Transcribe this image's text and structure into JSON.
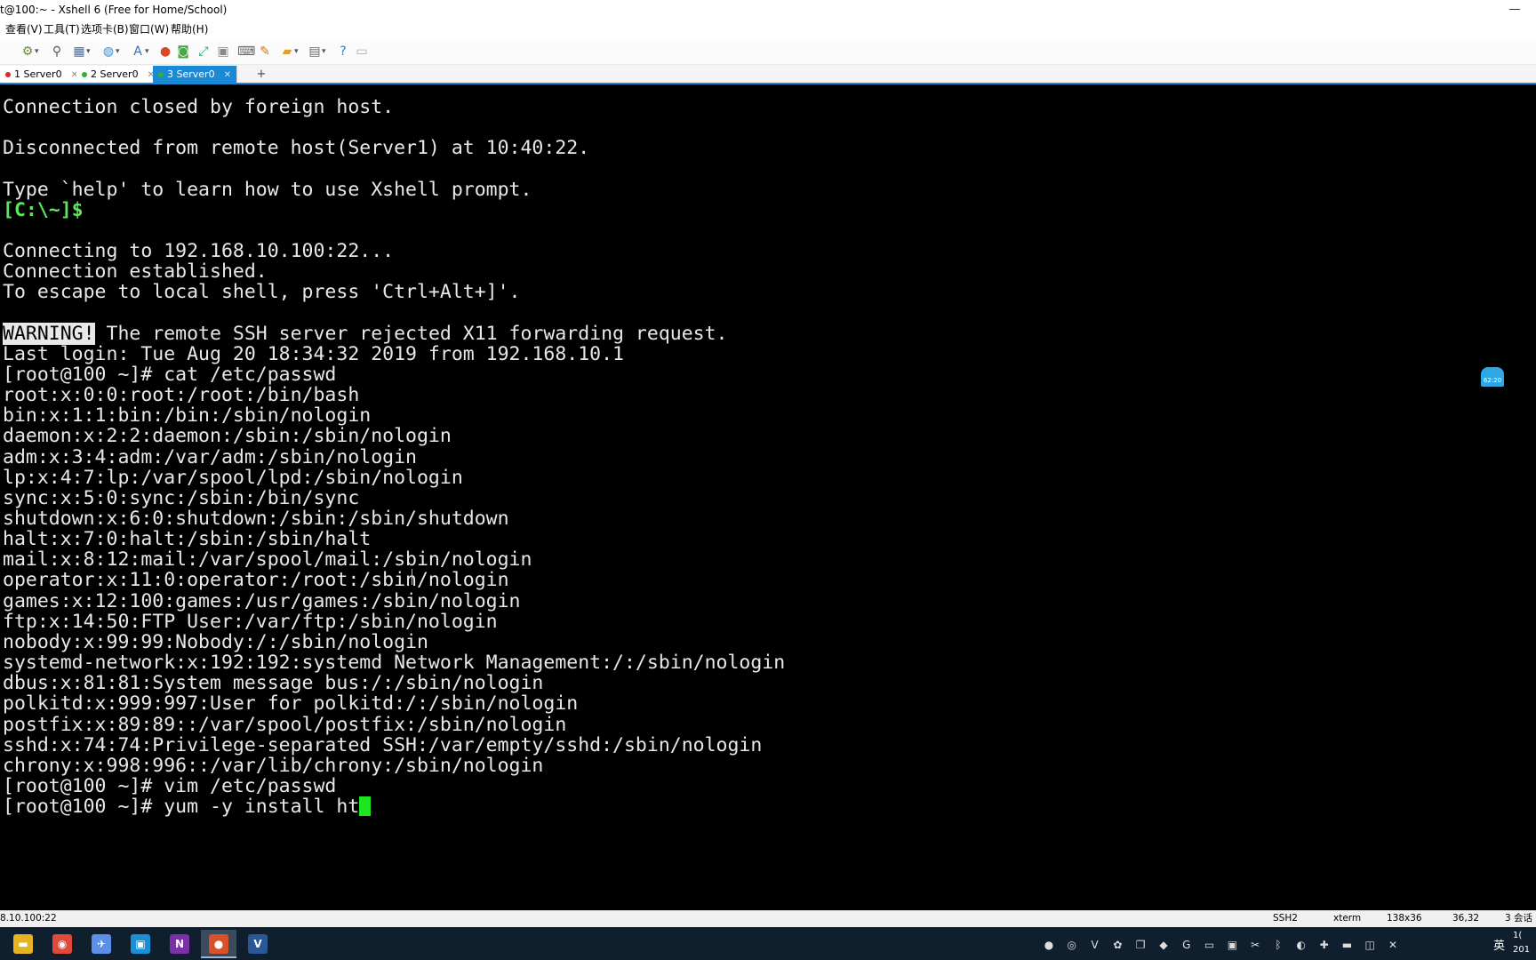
{
  "window": {
    "title": "t@100:~ - Xshell 6 (Free for Home/School)"
  },
  "menu": [
    "查看(V)",
    "工具(T)",
    "选项卡(B)",
    "窗口(W)",
    "帮助(H)"
  ],
  "toolbar_icons": [
    "properties-icon",
    "search-icon",
    "transfer-icon",
    "globe-icon",
    "font-icon",
    "xftp-icon",
    "tunnel-icon",
    "fullscreen-icon",
    "lock-icon",
    "keyboard-icon",
    "compose-icon",
    "folder-icon",
    "layout-icon",
    "help-icon",
    "chat-icon"
  ],
  "tabs": [
    {
      "label": "1 Server0",
      "dot_color": "#d62b2b",
      "active": false
    },
    {
      "label": "2 Server0",
      "dot_color": "#2fb02f",
      "active": false
    },
    {
      "label": "3 Server0",
      "dot_color": "#2fb02f",
      "active": true
    }
  ],
  "tab_add": "+",
  "terminal": {
    "lines": [
      "Connection closed by foreign host.",
      "",
      "Disconnected from remote host(Server1) at 10:40:22.",
      "",
      "Type `help' to learn how to use Xshell prompt.",
      "[C:\\~]$ ",
      "",
      "Connecting to 192.168.10.100:22...",
      "Connection established.",
      "To escape to local shell, press 'Ctrl+Alt+]'.",
      "",
      " The remote SSH server rejected X11 forwarding request.",
      "Last login: Tue Aug 20 18:34:32 2019 from 192.168.10.1",
      "[root@100 ~]# cat /etc/passwd",
      "root:x:0:0:root:/root:/bin/bash",
      "bin:x:1:1:bin:/bin:/sbin/nologin",
      "daemon:x:2:2:daemon:/sbin:/sbin/nologin",
      "adm:x:3:4:adm:/var/adm:/sbin/nologin",
      "lp:x:4:7:lp:/var/spool/lpd:/sbin/nologin",
      "sync:x:5:0:sync:/sbin:/bin/sync",
      "shutdown:x:6:0:shutdown:/sbin:/sbin/shutdown",
      "halt:x:7:0:halt:/sbin:/sbin/halt",
      "mail:x:8:12:mail:/var/spool/mail:/sbin/nologin",
      "operator:x:11:0:operator:/root:/sbin/nologin",
      "games:x:12:100:games:/usr/games:/sbin/nologin",
      "ftp:x:14:50:FTP User:/var/ftp:/sbin/nologin",
      "nobody:x:99:99:Nobody:/:/sbin/nologin",
      "systemd-network:x:192:192:systemd Network Management:/:/sbin/nologin",
      "dbus:x:81:81:System message bus:/:/sbin/nologin",
      "polkitd:x:999:997:User for polkitd:/:/sbin/nologin",
      "postfix:x:89:89::/var/spool/postfix:/sbin/nologin",
      "sshd:x:74:74:Privilege-separated SSH:/var/empty/sshd:/sbin/nologin",
      "chrony:x:998:996::/var/lib/chrony:/sbin/nologin",
      "[root@100 ~]# vim /etc/passwd",
      "[root@100 ~]# yum -y install ht"
    ],
    "warning_badge": "WARNING!",
    "local_prompt_line": 5,
    "warning_line": 11,
    "cursor_line": 34,
    "cursor_color": "#1ee61e"
  },
  "float_widget": {
    "label": "62:20"
  },
  "status": {
    "host": "8.10.100:22",
    "protocol": "SSH2",
    "term": "xterm",
    "size": "138x36",
    "position": "36,32",
    "sessions": "3 会话"
  },
  "taskbar": {
    "apps": [
      {
        "icon": "file-explorer-icon",
        "glyph": "▬",
        "color": "#e6b422"
      },
      {
        "icon": "chrome-icon",
        "glyph": "◉",
        "color": "#e04a3a"
      },
      {
        "icon": "feishu-icon",
        "glyph": "✈",
        "color": "#5b8fe8"
      },
      {
        "icon": "app-box-icon",
        "glyph": "▣",
        "color": "#1a8fd6"
      },
      {
        "icon": "onenote-icon",
        "glyph": "N",
        "color": "#7b2fa8"
      },
      {
        "icon": "xshell-icon",
        "glyph": "●",
        "color": "#d9502a"
      },
      {
        "icon": "visio-icon",
        "glyph": "V",
        "color": "#2b5797"
      }
    ],
    "active_app": 5,
    "tray_icons": [
      "balloon-icon",
      "network-drive-icon",
      "visio-tray-icon",
      "gear-tray-icon",
      "copy-tray-icon",
      "nvidia-icon",
      "g-tray-icon",
      "sb-tray-icon",
      "screen-tray-icon",
      "pin-tray-icon",
      "bluetooth-icon",
      "game-icon",
      "plus-tray-icon",
      "battery-icon",
      "wifi-icon",
      "volume-mute-icon"
    ],
    "ime": "英",
    "clock": [
      "1(",
      "201"
    ]
  }
}
